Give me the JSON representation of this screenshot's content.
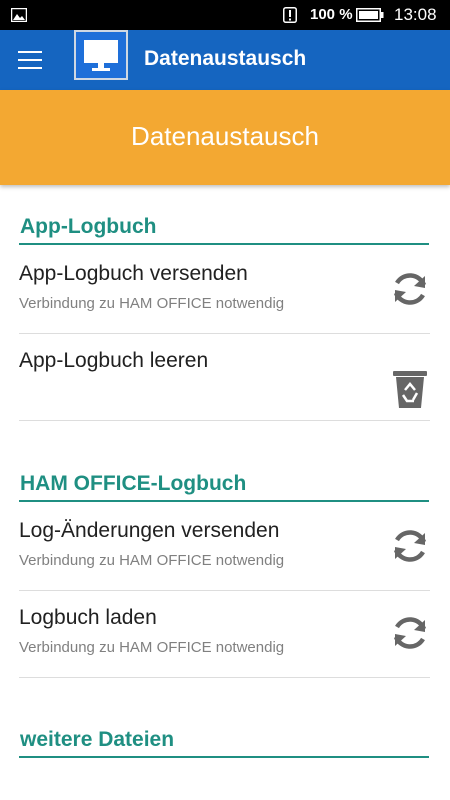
{
  "status_bar": {
    "battery_percent": "100 %",
    "time": "13:08"
  },
  "app_bar": {
    "title": "Datenaustausch",
    "menu_icon": "hamburger-menu-icon",
    "logo_icon": "monitor-icon"
  },
  "banner": {
    "title": "Datenaustausch",
    "color": "#f3a832"
  },
  "colors": {
    "app_bar": "#1565c0",
    "accent": "#1f8f82",
    "icon_gray": "#666666"
  },
  "sections": [
    {
      "header": "App-Logbuch",
      "items": [
        {
          "title": "App-Logbuch versenden",
          "subtitle": "Verbindung zu HAM OFFICE notwendig",
          "icon": "sync-icon"
        },
        {
          "title": "App-Logbuch leeren",
          "subtitle": "",
          "icon": "recycle-bin-icon"
        }
      ]
    },
    {
      "header": "HAM OFFICE-Logbuch",
      "items": [
        {
          "title": "Log-Änderungen versenden",
          "subtitle": "Verbindung zu HAM OFFICE notwendig",
          "icon": "sync-icon"
        },
        {
          "title": "Logbuch laden",
          "subtitle": "Verbindung zu HAM OFFICE notwendig",
          "icon": "sync-icon"
        }
      ]
    },
    {
      "header": "weitere Dateien",
      "items": []
    }
  ]
}
